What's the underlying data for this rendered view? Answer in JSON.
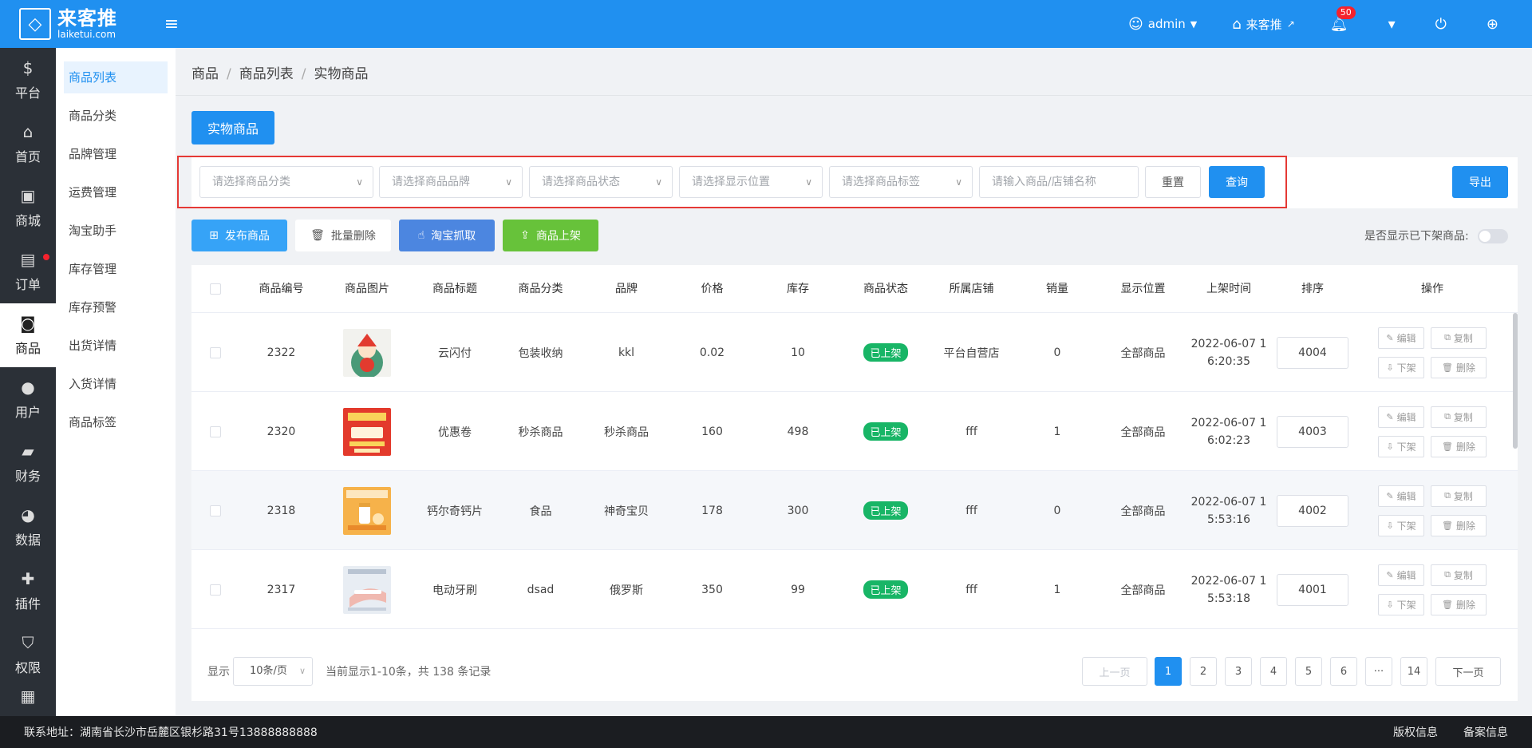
{
  "header": {
    "brand": "来客推",
    "domain": "laiketui.com",
    "user": "admin",
    "store": "来客推",
    "notifications": "50"
  },
  "sidebar": {
    "items": [
      {
        "label": "平台",
        "icon": "platform-icon"
      },
      {
        "label": "首页",
        "icon": "home-icon"
      },
      {
        "label": "商城",
        "icon": "mall-icon"
      },
      {
        "label": "订单",
        "icon": "order-icon"
      },
      {
        "label": "商品",
        "icon": "goods-icon"
      },
      {
        "label": "用户",
        "icon": "user-icon"
      },
      {
        "label": "财务",
        "icon": "wallet-icon"
      },
      {
        "label": "数据",
        "icon": "chart-icon"
      },
      {
        "label": "插件",
        "icon": "puzzle-icon"
      },
      {
        "label": "权限",
        "icon": "shield-icon"
      },
      {
        "label": "",
        "icon": "image-icon"
      }
    ],
    "active": 4
  },
  "submenu": {
    "items": [
      "商品列表",
      "商品分类",
      "品牌管理",
      "运费管理",
      "淘宝助手",
      "库存管理",
      "库存预警",
      "出货详情",
      "入货详情",
      "商品标签"
    ]
  },
  "breadcrumb": [
    "商品",
    "商品列表",
    "实物商品"
  ],
  "tab": "实物商品",
  "filters": {
    "category": "请选择商品分类",
    "brand": "请选择商品品牌",
    "status": "请选择商品状态",
    "position": "请选择显示位置",
    "tag": "请选择商品标签",
    "keyword_placeholder": "请输入商品/店铺名称",
    "reset": "重置",
    "search": "查询",
    "export": "导出"
  },
  "actions": {
    "publish": "发布商品",
    "batch_delete": "批量删除",
    "taobao": "淘宝抓取",
    "shelve": "商品上架",
    "show_offshelf": "是否显示已下架商品:"
  },
  "table": {
    "headers": [
      "商品编号",
      "商品图片",
      "商品标题",
      "商品分类",
      "品牌",
      "价格",
      "库存",
      "商品状态",
      "所属店铺",
      "销量",
      "显示位置",
      "上架时间",
      "排序",
      "操作"
    ],
    "ops": {
      "edit": "编辑",
      "copy": "复制",
      "offshelf": "下架",
      "delete": "删除"
    },
    "rows": [
      {
        "id": "2322",
        "title": "云闪付",
        "category": "包装收纳",
        "brand": "kkl",
        "price": "0.02",
        "stock": "10",
        "status": "已上架",
        "shop": "平台自营店",
        "sales": "0",
        "position": "全部商品",
        "time1": "2022-06-07 1",
        "time2": "6:20:35",
        "sort": "4004"
      },
      {
        "id": "2320",
        "title": "优惠卷",
        "category": "秒杀商品",
        "brand": "秒杀商品",
        "price": "160",
        "stock": "498",
        "status": "已上架",
        "shop": "fff",
        "sales": "1",
        "position": "全部商品",
        "time1": "2022-06-07 1",
        "time2": "6:02:23",
        "sort": "4003"
      },
      {
        "id": "2318",
        "title": "钙尔奇钙片",
        "category": "食品",
        "brand": "神奇宝贝",
        "price": "178",
        "stock": "300",
        "status": "已上架",
        "shop": "fff",
        "sales": "0",
        "position": "全部商品",
        "time1": "2022-06-07 1",
        "time2": "5:53:16",
        "sort": "4002"
      },
      {
        "id": "2317",
        "title": "电动牙刷",
        "category": "dsad",
        "brand": "俄罗斯",
        "price": "350",
        "stock": "99",
        "status": "已上架",
        "shop": "fff",
        "sales": "1",
        "position": "全部商品",
        "time1": "2022-06-07 1",
        "time2": "5:53:18",
        "sort": "4001"
      }
    ]
  },
  "pagination": {
    "show_label": "显示",
    "page_size": "10条/页",
    "summary": "当前显示1-10条，共 138 条记录",
    "prev": "上一页",
    "next": "下一页",
    "pages": [
      "1",
      "2",
      "3",
      "4",
      "5",
      "6",
      "···",
      "14"
    ],
    "current": "1"
  },
  "footer": {
    "address": "联系地址：湖南省长沙市岳麓区银杉路31号13888888888",
    "copyright": "版权信息",
    "record": "备案信息"
  },
  "colors": {
    "primary": "#2090f0",
    "success": "#18b566",
    "taobao": "#4c86e0",
    "shelve": "#67c23a",
    "publish": "#36a3f7"
  }
}
